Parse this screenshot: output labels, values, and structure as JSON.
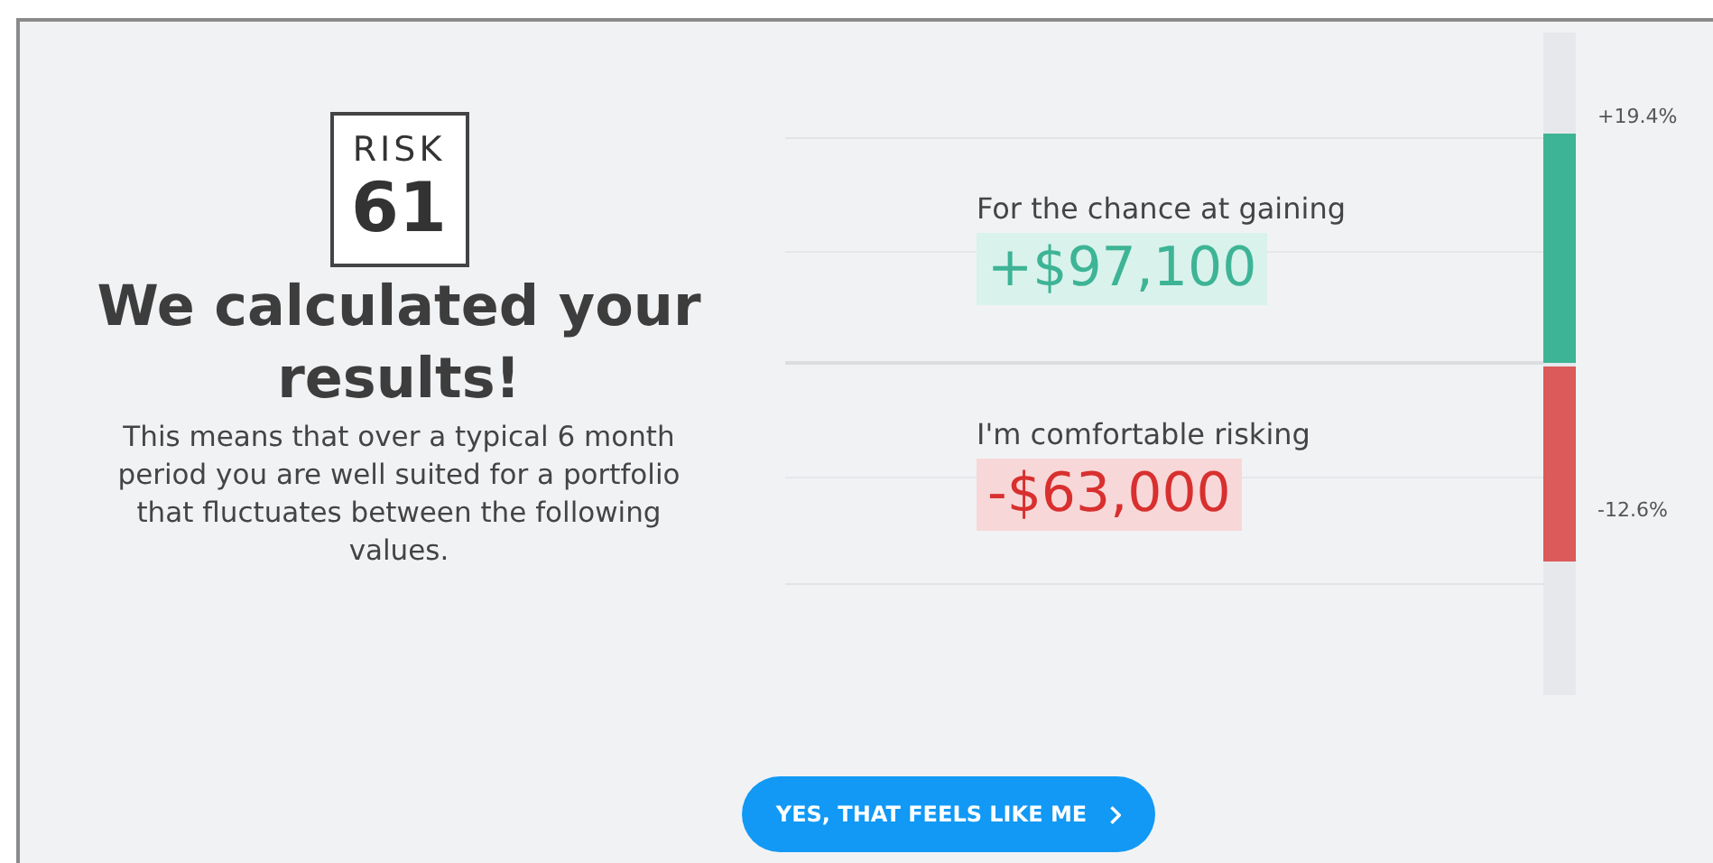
{
  "risk_badge": {
    "label": "RISK",
    "score": "61"
  },
  "heading": "We calculated your results!",
  "description": "This means that over a typical 6 month period you are well suited for a portfolio that fluctuates between the following values.",
  "outcomes": [
    {
      "kind": "gain",
      "caption": "For the chance at gaining",
      "amount": "+$97,100",
      "percent": "+19.4%"
    },
    {
      "kind": "loss",
      "caption": "I'm comfortable risking",
      "amount": "-$63,000",
      "percent": "-12.6%"
    }
  ],
  "confirm_button": {
    "label": "YES, THAT FEELS LIKE ME"
  }
}
